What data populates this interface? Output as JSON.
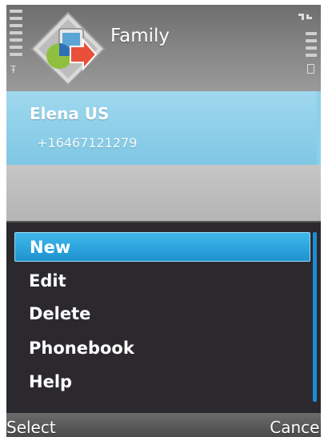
{
  "app": {
    "title": "Family",
    "icon": "contacts-app-icon"
  },
  "status": {
    "signal_icon": "signal-strength-icon",
    "battery_icon": "battery-icon",
    "indicator_icon": "data-connection-icon"
  },
  "contacts": [
    {
      "name": "Elena US",
      "number": "+16467121279"
    }
  ],
  "menu": {
    "items": [
      {
        "label": "New",
        "selected": true
      },
      {
        "label": "Edit",
        "selected": false
      },
      {
        "label": "Delete",
        "selected": false
      },
      {
        "label": "Phonebook",
        "selected": false
      },
      {
        "label": "Help",
        "selected": false
      }
    ]
  },
  "softkeys": {
    "left": "Select",
    "right": "Cancel"
  },
  "colors": {
    "highlight": "#1e92cf",
    "selected_contact": "#7fc7e4",
    "menu_background": "#2c292e"
  }
}
